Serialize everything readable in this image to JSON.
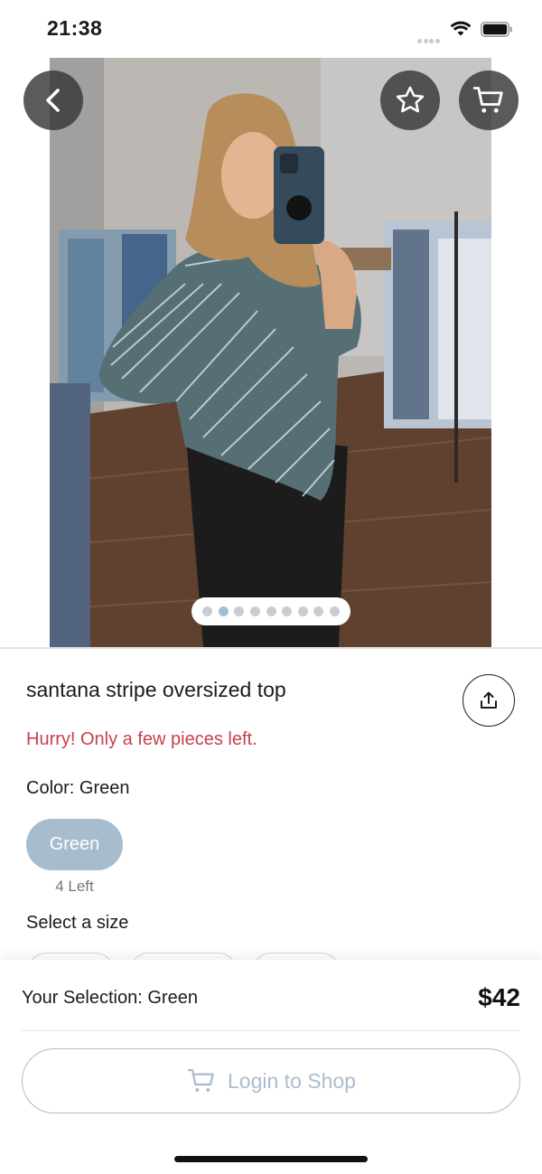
{
  "status_bar": {
    "time": "21:38"
  },
  "hero": {
    "pager_count": 9,
    "pager_active_index": 1
  },
  "product": {
    "title": "santana stripe oversized top",
    "stock_warning": "Hurry! Only a few pieces left.",
    "color_label": "Color:",
    "color_value": "Green",
    "color_option": "Green",
    "color_option_stock": "4 Left",
    "size_label": "Select a size"
  },
  "bottom_bar": {
    "selection_text": "Your Selection: Green",
    "price": "$42",
    "login_label": "Login to Shop"
  },
  "icons": {
    "back": "chevron-left-icon",
    "favorite": "star-icon",
    "cart": "cart-icon",
    "share": "share-icon",
    "login": "cart-icon"
  },
  "colors": {
    "accent": "#a9bdcf",
    "chip": "#a7bccd",
    "warning": "#c8404d",
    "button_overlay": "#373737"
  }
}
